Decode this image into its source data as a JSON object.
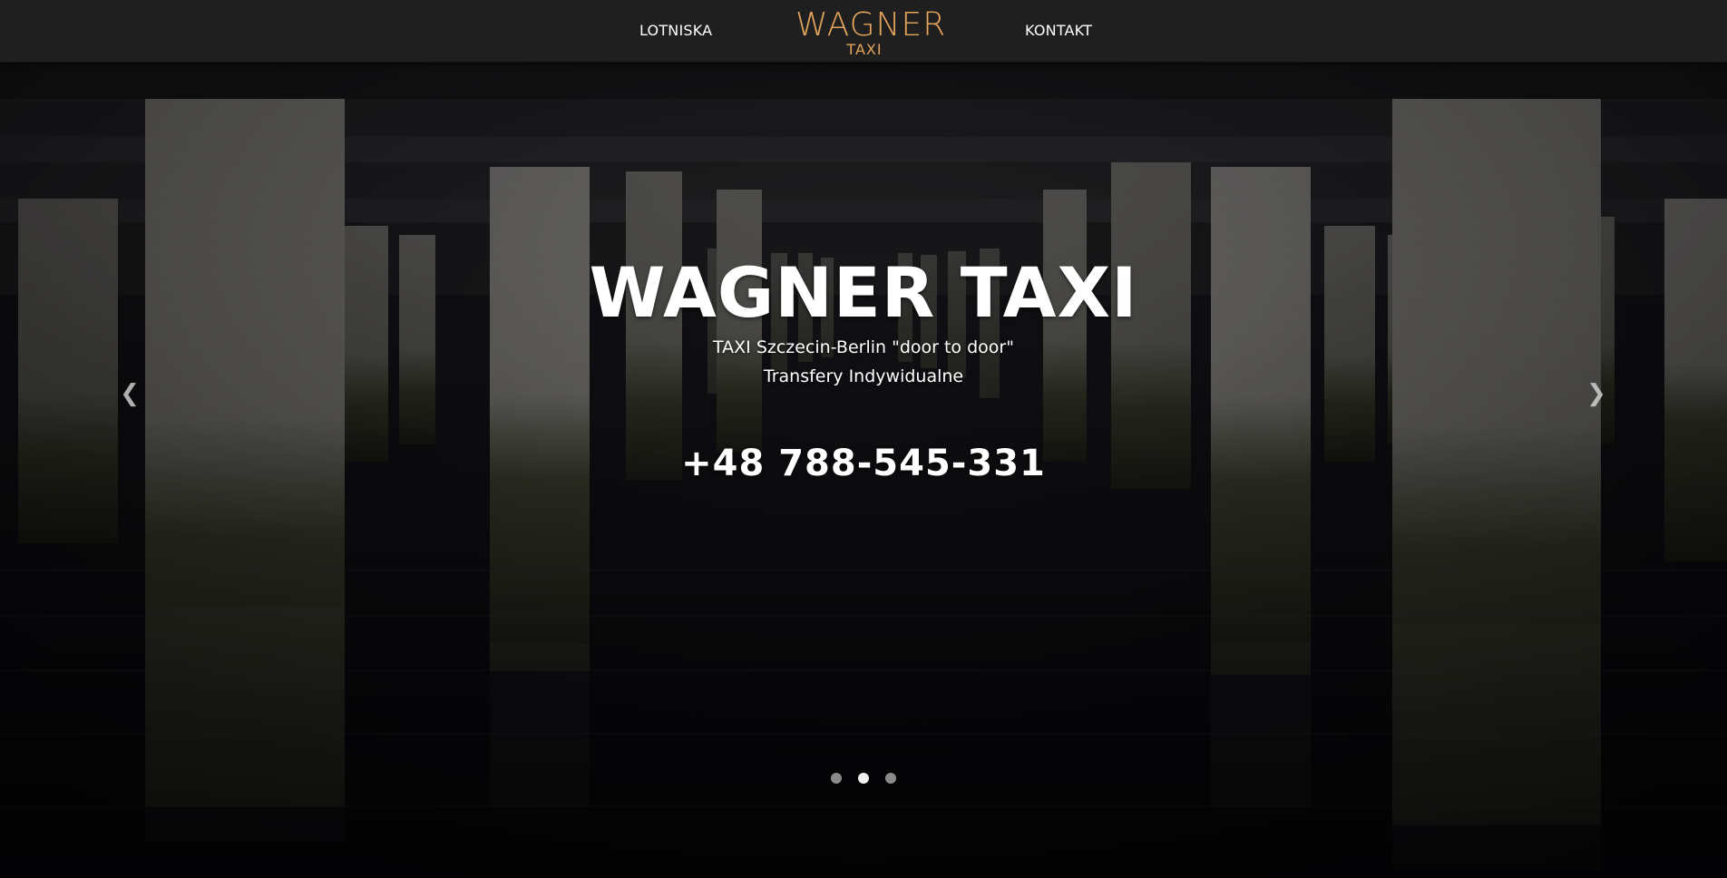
{
  "navbar": {
    "left_link": "LOTNISKA",
    "right_link": "KONTAKT",
    "logo": {
      "main": "WAGNER",
      "sub": "TAXI",
      "color": "#e4a45a"
    }
  },
  "hero": {
    "title": "WAGNER TAXI",
    "subtitle_line1": "TAXI Szczecin-Berlin \"door to door\"",
    "subtitle_line2": "Transfery Indywidualne",
    "phone": "+48 788-545-331",
    "prev_icon": "chevron-left-icon",
    "next_icon": "chevron-right-icon",
    "prev_glyph": "❮",
    "next_glyph": "❯",
    "indicators": {
      "count": 3,
      "active": 2
    }
  },
  "colors": {
    "navbar_bg": "#1f1f1f",
    "text": "#ffffff",
    "accent": "#e4a45a"
  }
}
